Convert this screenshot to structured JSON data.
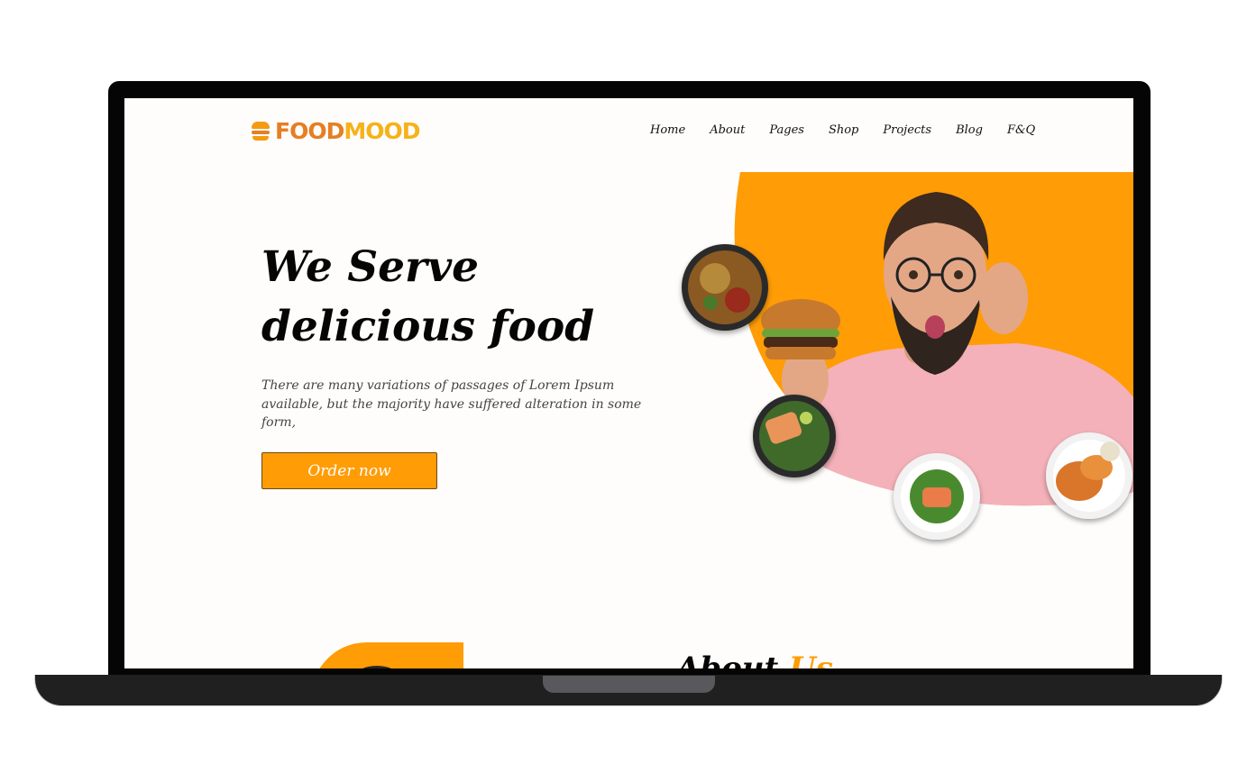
{
  "brand": {
    "name_part1": "FOOD",
    "name_part2": "MOOD"
  },
  "nav": {
    "items": [
      "Home",
      "About",
      "Pages",
      "Shop",
      "Projects",
      "Blog",
      "F&Q"
    ]
  },
  "hero": {
    "title": "We Serve delicious food",
    "description": "There are many variations of passages of Lorem Ipsum available, but the majority have suffered alteration in some form,",
    "cta_label": "Order now"
  },
  "about": {
    "title_part1": "About",
    "title_part2": "Us"
  },
  "colors": {
    "accent": "#ff9c06",
    "logo_primary": "#e67e22",
    "logo_secondary": "#f6b21b",
    "shirt": "#f4b1b9",
    "laptop_frame": "#050505"
  },
  "icons": [
    "burger-logo-icon"
  ]
}
